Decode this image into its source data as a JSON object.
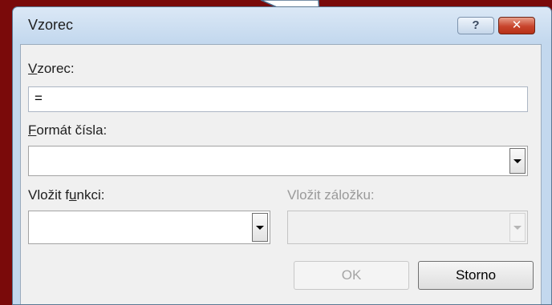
{
  "dialog": {
    "title": "Vzorec",
    "help_glyph": "?",
    "close_glyph": "✕"
  },
  "formula": {
    "label_underlined": "V",
    "label_rest": "zorec:",
    "value": "="
  },
  "number_format": {
    "label_underlined": "F",
    "label_rest": "ormát čísla:",
    "value": ""
  },
  "paste_function": {
    "label_prefix": "Vložit f",
    "label_underlined": "u",
    "label_rest": "nkci:",
    "value": ""
  },
  "paste_bookmark": {
    "label": "Vložit záložku:",
    "value": "",
    "disabled": true
  },
  "buttons": {
    "ok": "OK",
    "cancel": "Storno"
  },
  "icons": [
    "help-icon",
    "close-icon",
    "dropdown-arrow-icon"
  ]
}
